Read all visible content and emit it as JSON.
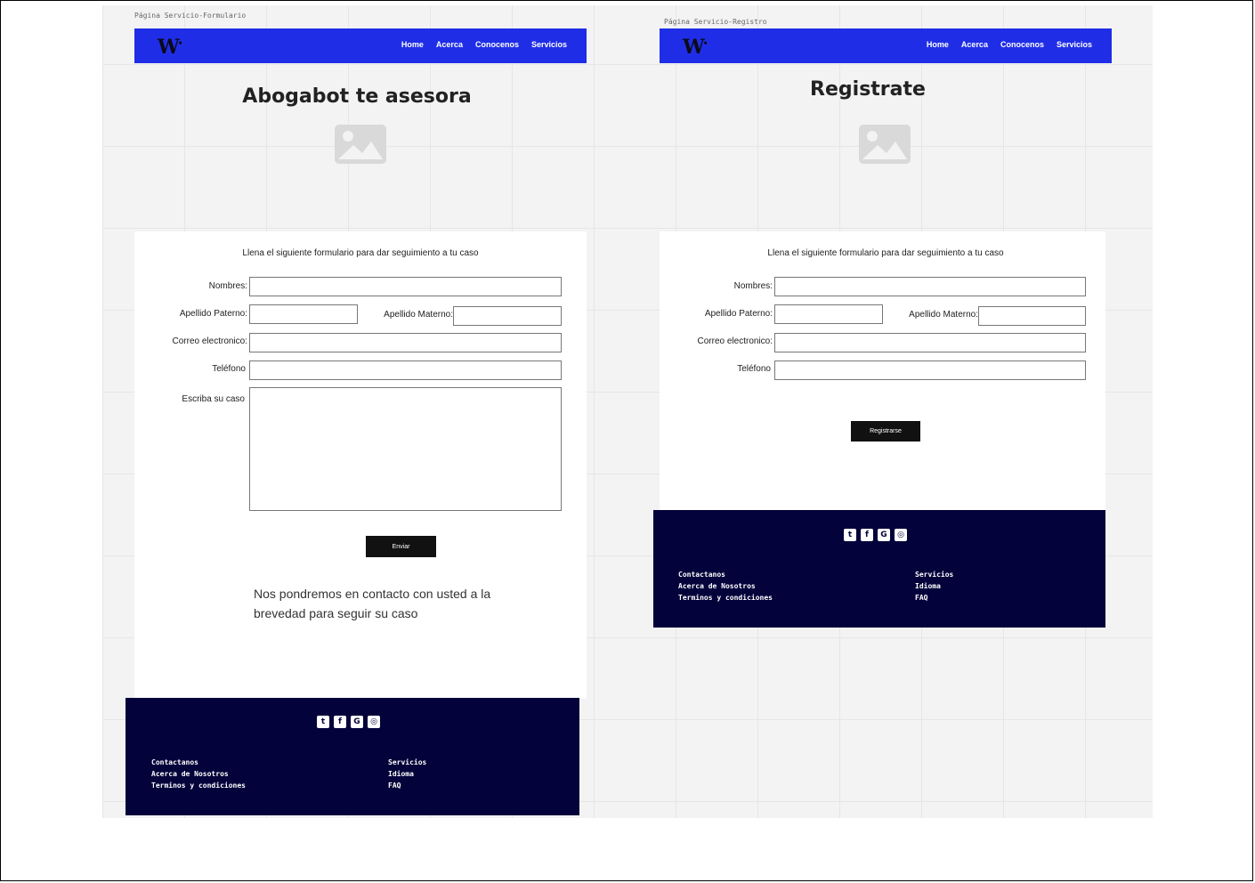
{
  "left_artboard": {
    "label": "Página Servicio-Formulario",
    "nav": {
      "logo": "W",
      "links": [
        "Home",
        "Acerca",
        "Conocenos",
        "Servicios"
      ]
    },
    "hero_title": "Abogabot te asesora",
    "form": {
      "intro": "Llena el siguiente formulario para dar seguimiento a tu caso",
      "labels": {
        "nombres": "Nombres:",
        "apellido_paterno": "Apellido Paterno:",
        "apellido_materno": "Apellido Materno:",
        "correo": "Correo electronico:",
        "telefono": "Teléfono",
        "caso": "Escriba su caso"
      },
      "submit_label": "Enviar",
      "note": "Nos pondremos en contacto con usted a la brevedad para seguir su caso"
    },
    "footer": {
      "col1": [
        "Contactanos",
        "Acerca de Nosotros",
        "Terminos y condiciones"
      ],
      "col2": [
        "Servicios",
        "Idioma",
        "FAQ"
      ]
    }
  },
  "right_artboard": {
    "label": "Página Servicio-Registro",
    "nav": {
      "logo": "W",
      "links": [
        "Home",
        "Acerca",
        "Conocenos",
        "Servicios"
      ]
    },
    "hero_title": "Registrate",
    "form": {
      "intro": "Llena el siguiente formulario para dar seguimiento a tu caso",
      "labels": {
        "nombres": "Nombres:",
        "apellido_paterno": "Apellido Paterno:",
        "apellido_materno": "Apellido Materno:",
        "correo": "Correo electronico:",
        "telefono": "Teléfono"
      },
      "submit_label": "Registrarse"
    },
    "footer": {
      "col1": [
        "Contactanos",
        "Acerca de Nosotros",
        "Terminos y condiciones"
      ],
      "col2": [
        "Servicios",
        "Idioma",
        "FAQ"
      ]
    }
  },
  "social_icons": [
    "twitter-icon",
    "facebook-icon",
    "google-plus-icon",
    "instagram-icon"
  ],
  "colors": {
    "nav": "#1f2ee6",
    "footer": "#03023a",
    "button": "#111111"
  }
}
